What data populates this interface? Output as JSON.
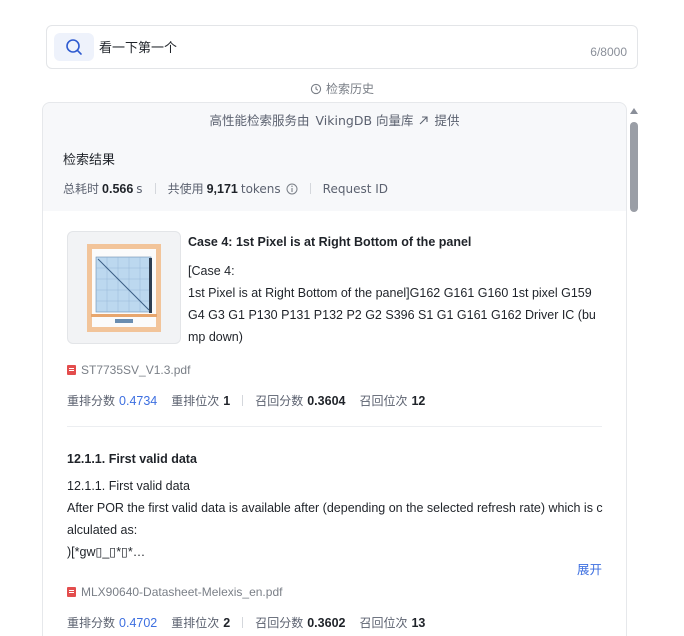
{
  "search": {
    "value": "看一下第一个",
    "counter": "6/8000"
  },
  "history": {
    "label": "检索历史"
  },
  "provider": {
    "prefix": "高性能检索服务由",
    "link": "VikingDB 向量库",
    "suffix": "提供"
  },
  "summary": {
    "title": "检索结果",
    "time_label": "总耗时",
    "time_value": "0.566",
    "time_unit": "s",
    "tokens_label": "共使用",
    "tokens_value": "9,171",
    "tokens_unit": "tokens",
    "request_id_label": "Request ID"
  },
  "results": [
    {
      "title": "Case 4: 1st Pixel is at Right Bottom of the panel",
      "body_line1": "[Case 4:",
      "body_line2": "1st Pixel is at Right Bottom of the panel]G162 G161 G160 1st pixel G159 G4 G3 G1 P130 P131 P132 P2 G2 S396 S1 G1 G161 G162 Driver IC (bump down)",
      "file": "ST7735SV_V1.3.pdf",
      "rerank_score_label": "重排分数",
      "rerank_score": "0.4734",
      "rerank_rank_label": "重排位次",
      "rerank_rank": "1",
      "recall_score_label": "召回分数",
      "recall_score": "0.3604",
      "recall_rank_label": "召回位次",
      "recall_rank": "12"
    },
    {
      "title": "12.1.1. First valid data",
      "body_line1": "12.1.1. First valid data",
      "body_line2": "After POR the first valid data is available after (depending on the selected refresh rate) which is calculated as:",
      "body_line3": ")[*gw▯_▯*▯*…",
      "expand_label": "展开",
      "file": "MLX90640-Datasheet-Melexis_en.pdf",
      "rerank_score_label": "重排分数",
      "rerank_score": "0.4702",
      "rerank_rank_label": "重排位次",
      "rerank_rank": "2",
      "recall_score_label": "召回分数",
      "recall_score": "0.3602",
      "recall_rank_label": "召回位次",
      "recall_rank": "13"
    }
  ],
  "colors": {
    "accent": "#3d6fe0",
    "pdf": "#e34d4d"
  }
}
